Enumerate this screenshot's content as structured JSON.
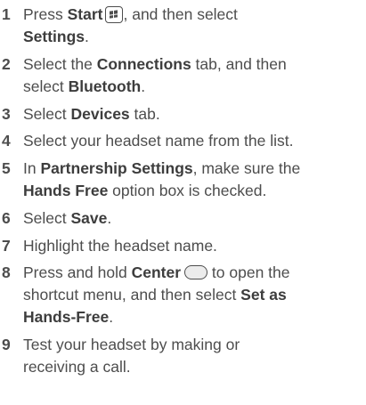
{
  "steps": [
    {
      "num": "1",
      "l1": {
        "a": "Press ",
        "b": "Start",
        "c": ", and then select"
      },
      "l2": {
        "b": "Settings",
        "c": "."
      }
    },
    {
      "num": "2",
      "l1": {
        "a": "Select the ",
        "b": "Connections",
        "c": " tab, and then"
      },
      "l2": {
        "a": "select ",
        "b": "Bluetooth",
        "c": "."
      }
    },
    {
      "num": "3",
      "l1": {
        "a": "Select ",
        "b": "Devices",
        "c": " tab."
      }
    },
    {
      "num": "4",
      "l1": {
        "a": "Select your headset name from the list."
      }
    },
    {
      "num": "5",
      "l1": {
        "a": "In ",
        "b": "Partnership Settings",
        "c": ", make sure the"
      },
      "l2": {
        "b": "Hands Free",
        "c": " option box is checked."
      }
    },
    {
      "num": "6",
      "l1": {
        "a": "Select ",
        "b": "Save",
        "c": "."
      }
    },
    {
      "num": "7",
      "l1": {
        "a": "Highlight the headset name."
      }
    },
    {
      "num": "8",
      "l1": {
        "a": "Press and hold ",
        "b": "Center",
        "c": " to open the"
      },
      "l2": {
        "a": "shortcut menu, and then select ",
        "b": "Set as"
      },
      "l3": {
        "b": "Hands-Free",
        "c": "."
      }
    },
    {
      "num": "9",
      "l1": {
        "a": "Test your headset by making or"
      },
      "l2": {
        "a": "receiving a call."
      }
    }
  ],
  "icons": {
    "start": "windows-start-key-icon",
    "center": "center-button-icon"
  }
}
